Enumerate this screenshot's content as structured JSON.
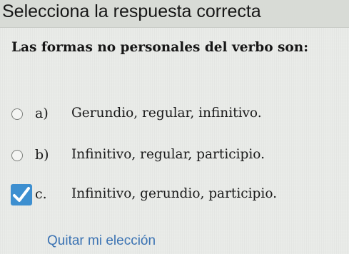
{
  "header": {
    "title": "Selecciona la respuesta correcta"
  },
  "question": {
    "text": "Las formas no personales del verbo son:"
  },
  "options": [
    {
      "letter": "a)",
      "text": "Gerundio, regular, infinitivo.",
      "selected": false
    },
    {
      "letter": "b)",
      "text": "Infinitivo, regular, participio.",
      "selected": false
    },
    {
      "letter": "c.",
      "text": "Infinitivo, gerundio, participio.",
      "selected": true
    }
  ],
  "actions": {
    "clear_label": "Quitar mi elección"
  },
  "colors": {
    "accent": "#3d8fd0",
    "link": "#3b73b3"
  },
  "icons": {
    "selected": "check-icon"
  }
}
